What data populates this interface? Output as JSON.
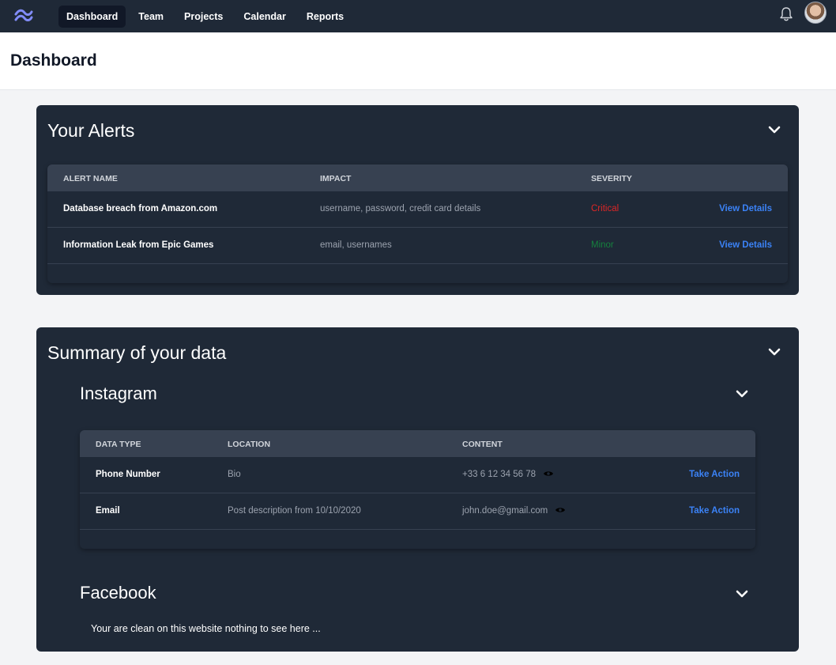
{
  "nav": {
    "links": [
      "Dashboard",
      "Team",
      "Projects",
      "Calendar",
      "Reports"
    ],
    "active": "Dashboard",
    "icons": {
      "logo": "wave-logo-icon",
      "notifications": "bell-icon",
      "profile": "avatar"
    }
  },
  "page": {
    "title": "Dashboard"
  },
  "alerts": {
    "title": "Your Alerts",
    "columns": [
      "ALERT NAME",
      "IMPACT",
      "SEVERITY"
    ],
    "rows": [
      {
        "name": "Database breach from Amazon.com",
        "impact": "username, password, credit card details",
        "severity": "Critical",
        "action": "View Details"
      },
      {
        "name": "Information Leak from Epic Games",
        "impact": "email, usernames",
        "severity": "Minor",
        "action": "View Details"
      }
    ]
  },
  "summary": {
    "title": "Summary of your data",
    "instagram": {
      "title": "Instagram",
      "columns": [
        "DATA TYPE",
        "LOCATION",
        "CONTENT"
      ],
      "rows": [
        {
          "type": "Phone Number",
          "location": "Bio",
          "content": "+33 6 12 34 56 78",
          "action": "Take Action"
        },
        {
          "type": "Email",
          "location": "Post description from 10/10/2020",
          "content": "john.doe@gmail.com",
          "action": "Take Action"
        }
      ]
    },
    "facebook": {
      "title": "Facebook",
      "message": "Your are clean on this website nothing to see here ..."
    }
  },
  "colors": {
    "nav_bg": "#1f2937",
    "card_bg": "#1f2937",
    "table_header_bg": "#374151",
    "critical": "#dc2626",
    "minor": "#15803d",
    "link": "#3b82f6",
    "logo": "#818cf8"
  }
}
